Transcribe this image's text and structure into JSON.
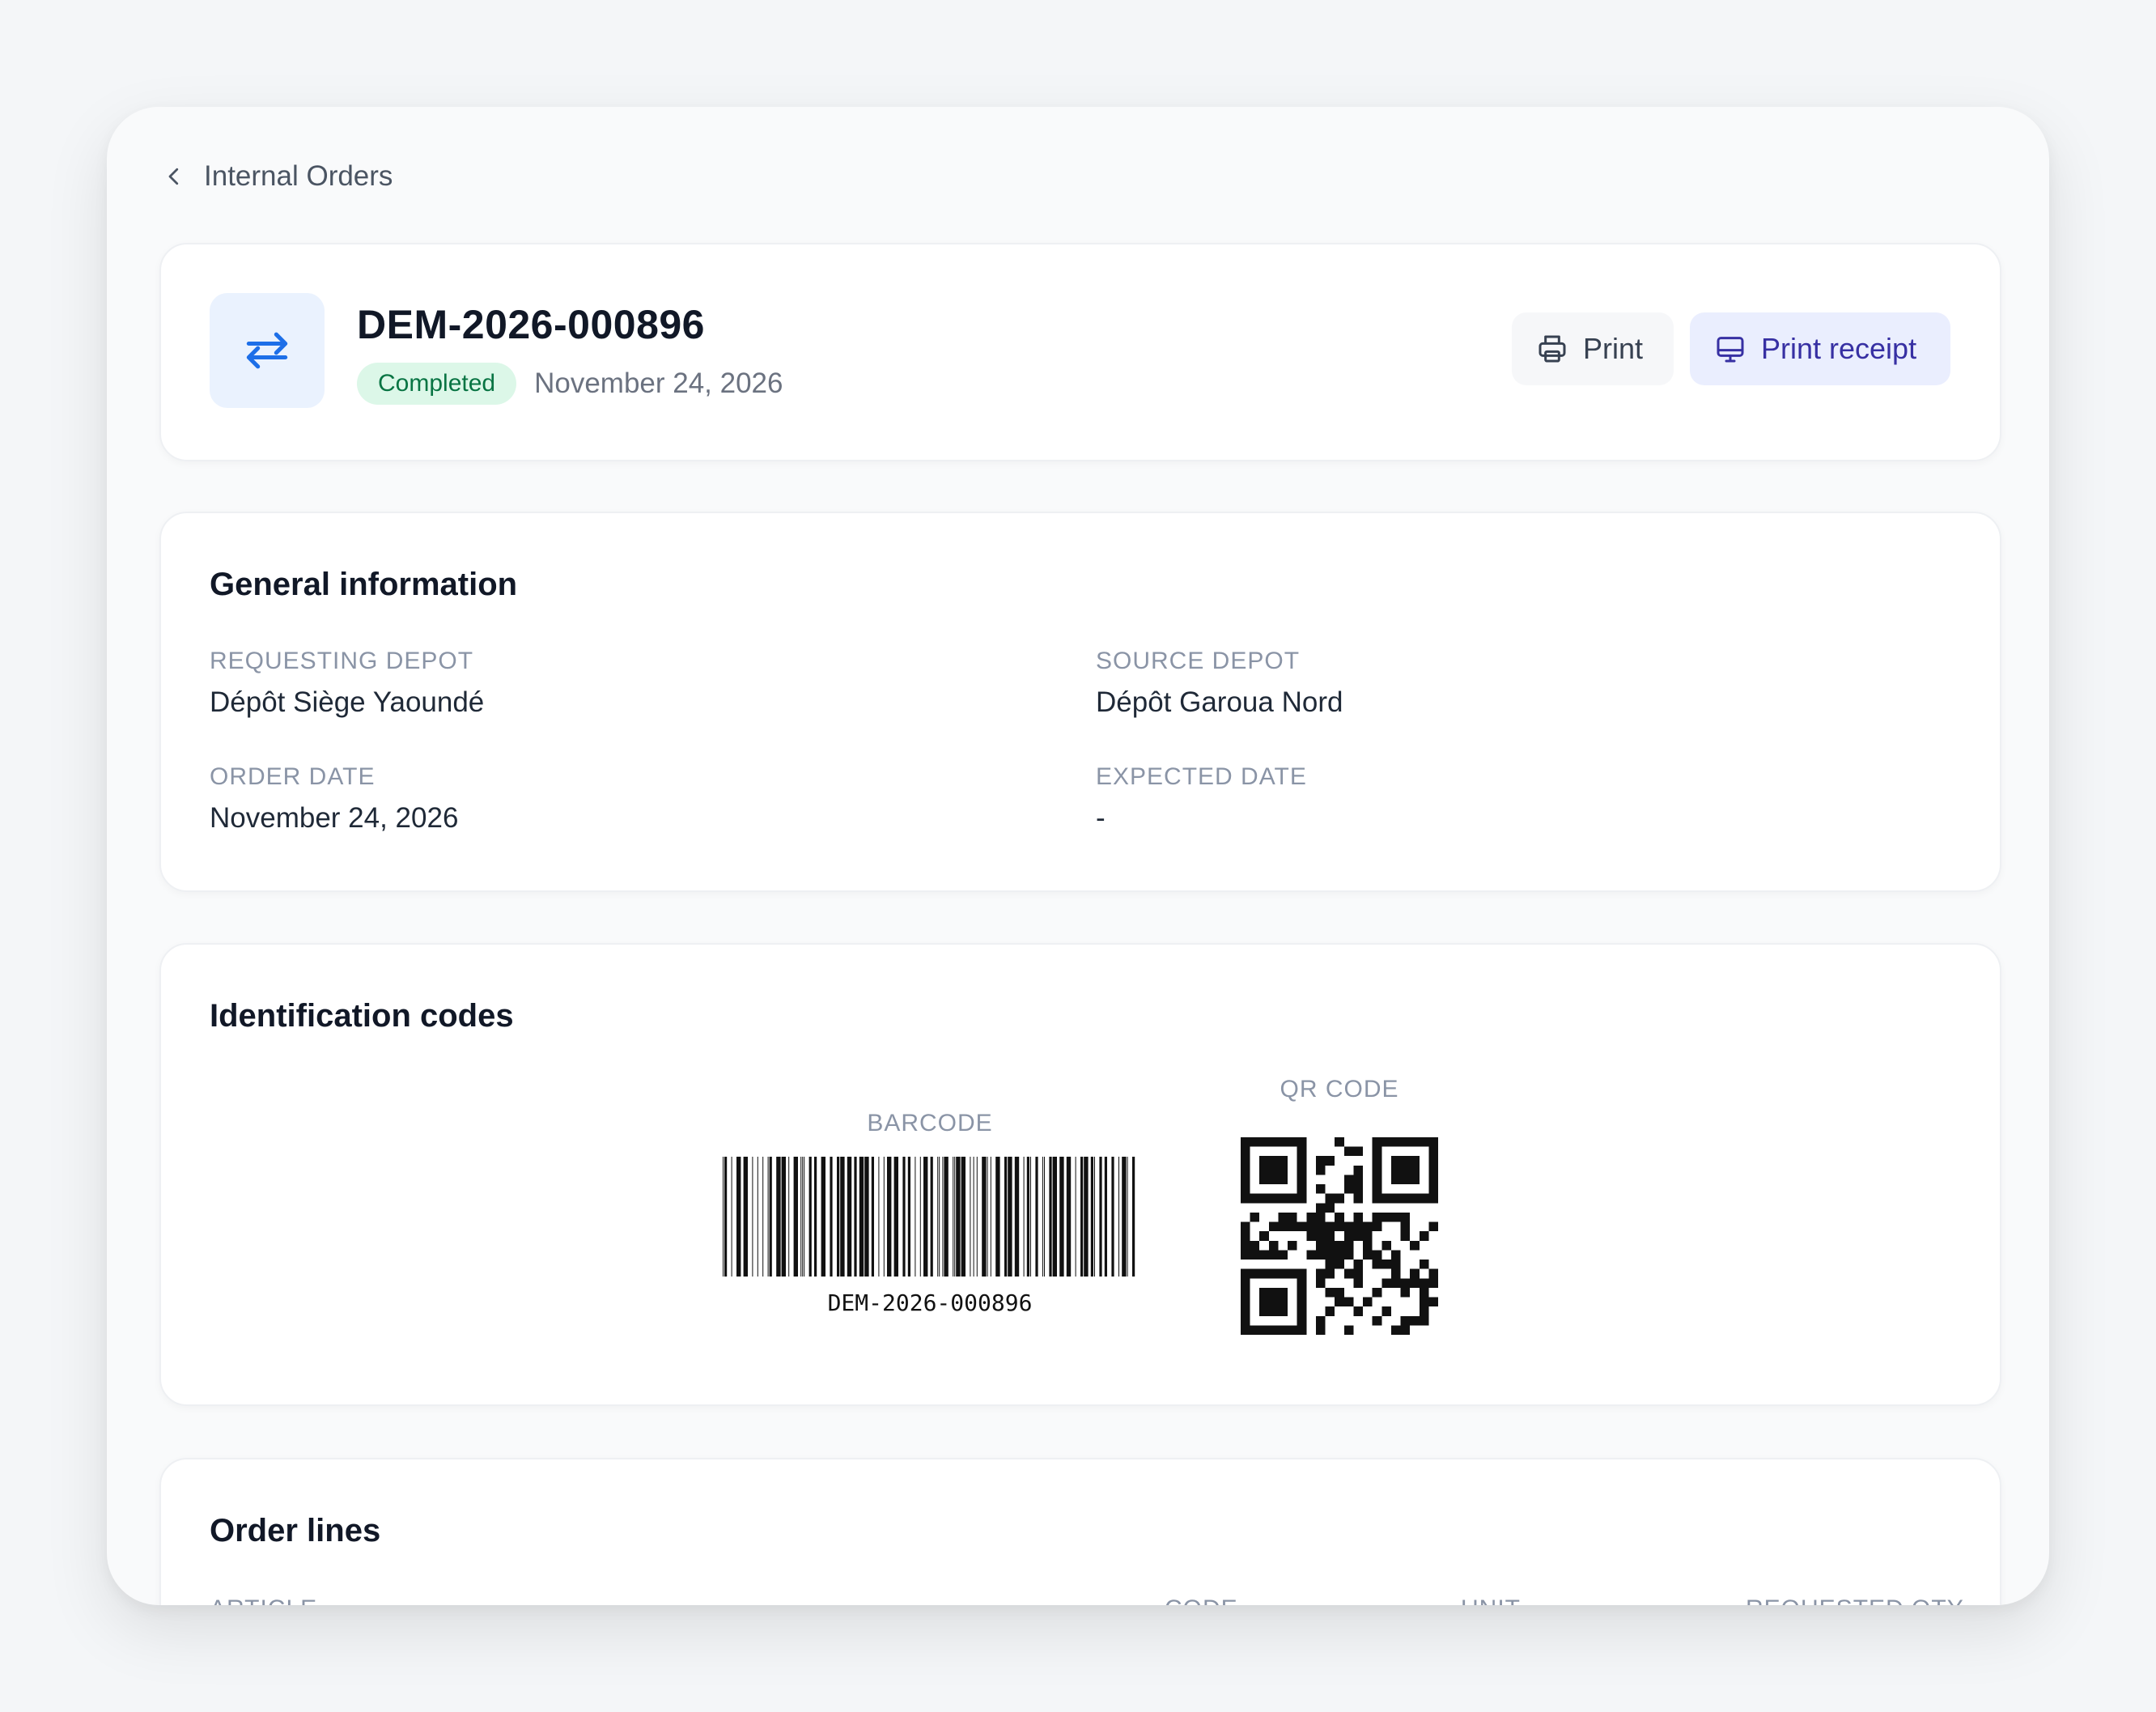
{
  "back": {
    "label": "Internal Orders"
  },
  "order": {
    "number": "DEM-2026-000896",
    "status": "Completed",
    "date": "November 24, 2026"
  },
  "actions": {
    "print": "Print",
    "print_receipt": "Print receipt"
  },
  "general": {
    "title": "General information",
    "requesting_depot": {
      "label": "REQUESTING DEPOT",
      "value": "Dépôt Siège Yaoundé"
    },
    "source_depot": {
      "label": "SOURCE DEPOT",
      "value": "Dépôt Garoua Nord"
    },
    "order_date": {
      "label": "ORDER DATE",
      "value": "November 24, 2026"
    },
    "expected_date": {
      "label": "EXPECTED DATE",
      "value": "-"
    }
  },
  "codes": {
    "title": "Identification codes",
    "barcode_label": "BARCODE",
    "barcode_text": "DEM-2026-000896",
    "qr_label": "QR CODE"
  },
  "lines": {
    "title": "Order lines",
    "columns": [
      "ARTICLE",
      "CODE",
      "UNIT",
      "REQUESTED QTY"
    ]
  },
  "colors": {
    "accent": "#1d6fe8",
    "status_bg": "#dcf7e8",
    "status_text": "#087443",
    "receipt_bg": "#eaeefe",
    "receipt_text": "#3730a3"
  },
  "icons": {
    "back": "chevron-left-icon",
    "order": "transfer-arrows-icon",
    "print": "printer-icon",
    "receipt": "monitor-icon"
  }
}
